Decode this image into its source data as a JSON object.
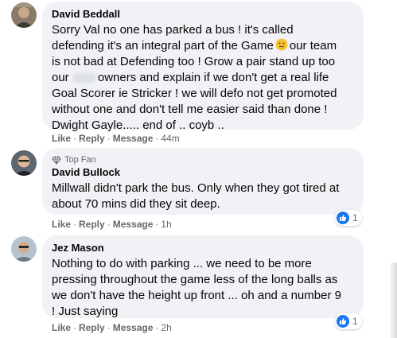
{
  "comments": [
    {
      "author": "David Beddall",
      "lines": [
        "Sorry Val no one has parked a bus ! it's called",
        "defending it's an integral part of the Game",
        "our team",
        "is not bad at Defending too ! Grow a pair stand up too",
        "our",
        "owners and explain if we don't get a real life",
        "Goal Scorer ie Stricker ! we will defo not get promoted",
        "without one and don't tell me easier said than done !",
        "Dwight Gayle..... end of .. coyb .."
      ],
      "actions": {
        "like": "Like",
        "reply": "Reply",
        "message": "Message",
        "time": "44m"
      }
    },
    {
      "badge": "Top Fan",
      "author": "David Bullock",
      "lines": [
        "Millwall didn't park the bus. Only when they got tired at",
        "about 70 mins did they sit deep."
      ],
      "actions": {
        "like": "Like",
        "reply": "Reply",
        "message": "Message",
        "time": "1h"
      },
      "reaction_count": "1"
    },
    {
      "author": "Jez Mason",
      "lines": [
        "Nothing to do with parking ... we need to be more",
        "pressing throughout the game less of the long balls as",
        "we don't have the height up front ... oh and a number 9",
        "! Just saying"
      ],
      "actions": {
        "like": "Like",
        "reply": "Reply",
        "message": "Message",
        "time": "2h"
      },
      "reaction_count": "1"
    }
  ],
  "separator": "·",
  "colors": {
    "bubble": "#f0f2f5",
    "text": "#050505",
    "meta": "#65676b",
    "like_blue": "#1877f2"
  },
  "icons": {
    "emoji": "thinking-face-emoji",
    "top_fan": "diamond-icon",
    "reaction": "like-icon"
  }
}
